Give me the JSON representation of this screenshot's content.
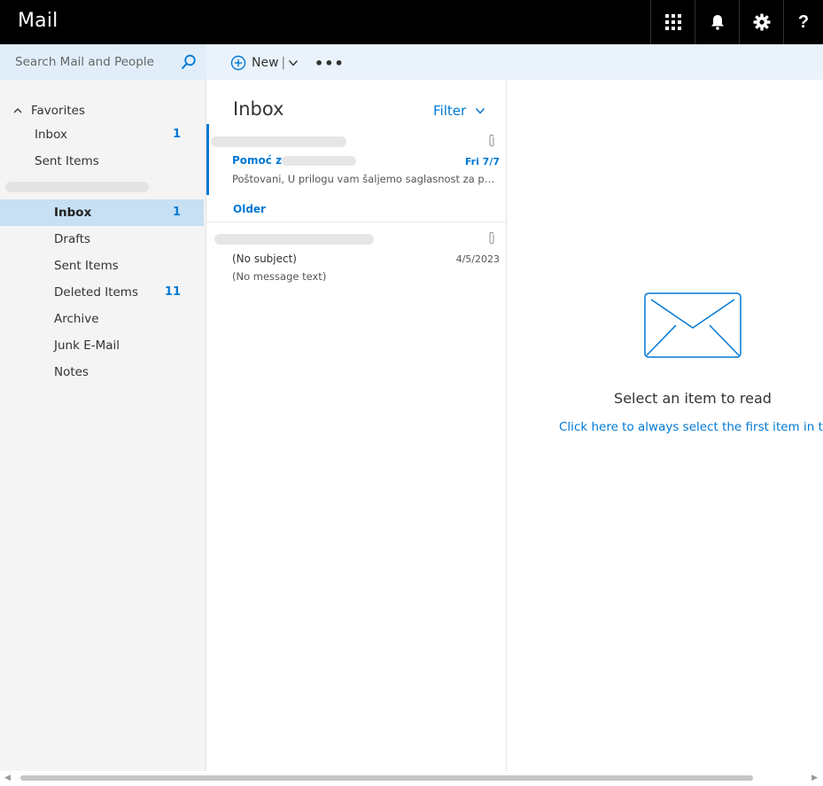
{
  "app": {
    "title": "Mail"
  },
  "topbar": {
    "icons": [
      "app-launcher-icon",
      "bell-icon",
      "gear-icon",
      "help-icon"
    ],
    "help_label": "?"
  },
  "search": {
    "placeholder": "Search Mail and People"
  },
  "command_bar": {
    "new_label": "New",
    "separator": "|",
    "more_label": "•••"
  },
  "nav": {
    "favorites_label": "Favorites",
    "favorites": [
      {
        "label": "Inbox",
        "count": "1"
      },
      {
        "label": "Sent Items",
        "count": ""
      }
    ],
    "folders": [
      {
        "label": "Inbox",
        "count": "1",
        "selected": true
      },
      {
        "label": "Drafts",
        "count": ""
      },
      {
        "label": "Sent Items",
        "count": ""
      },
      {
        "label": "Deleted Items",
        "count": "11"
      },
      {
        "label": "Archive",
        "count": ""
      },
      {
        "label": "Junk E-Mail",
        "count": ""
      },
      {
        "label": "Notes",
        "count": ""
      }
    ]
  },
  "message_list": {
    "title": "Inbox",
    "filter_label": "Filter",
    "groups": {
      "older_label": "Older"
    },
    "messages": [
      {
        "subject": "Pomoć za",
        "date": "Fri 7/7",
        "preview": "Poštovani, U prilogu vam šaljemo saglasnost za p…",
        "unread": true,
        "has_attachment": true
      },
      {
        "subject": "(No subject)",
        "date": "4/5/2023",
        "preview": "(No message text)",
        "unread": false,
        "has_attachment": true
      }
    ]
  },
  "reading_pane": {
    "empty_title": "Select an item to read",
    "link_text": "Click here to always select the first item in the lis"
  },
  "colors": {
    "accent": "#0078d4",
    "topbar": "#000000",
    "selected_folder": "#c7e0f4",
    "command_bar": "#eaf3fc"
  }
}
